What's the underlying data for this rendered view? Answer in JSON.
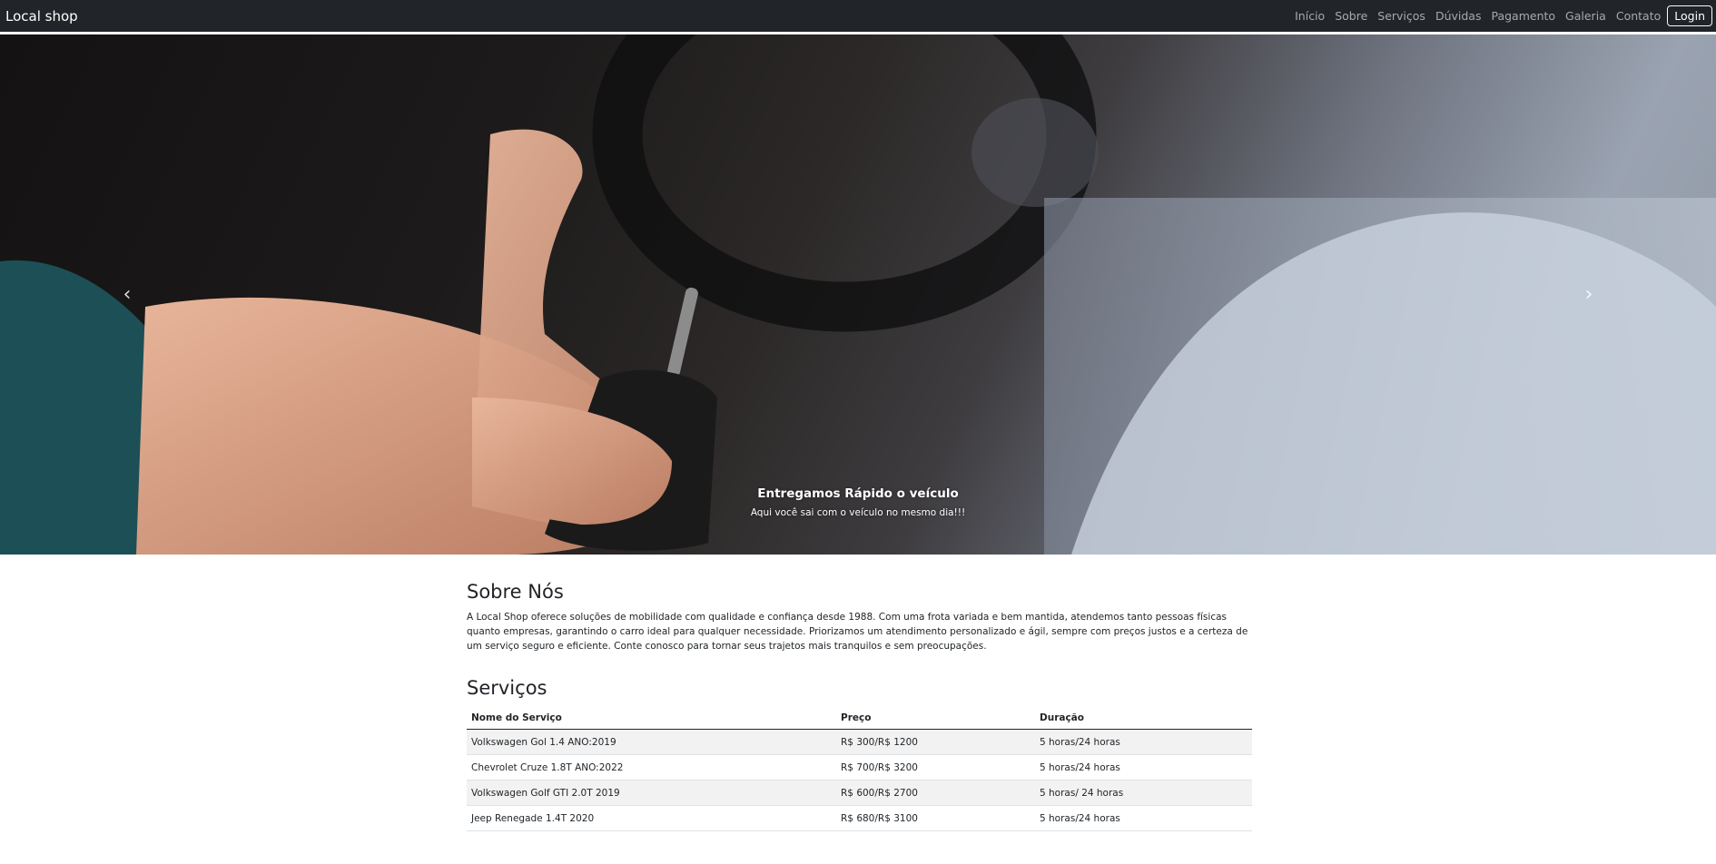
{
  "navbar": {
    "brand": "Local shop",
    "links": [
      "Início",
      "Sobre",
      "Serviços",
      "Dúvidas",
      "Pagamento",
      "Galeria",
      "Contato"
    ],
    "login_label": "Login"
  },
  "carousel": {
    "caption_title": "Entregamos Rápido o veículo",
    "caption_text": "Aqui você sai com o veículo no mesmo dia!!!",
    "prev_icon": "chevron-left-icon",
    "next_icon": "chevron-right-icon"
  },
  "about": {
    "title": "Sobre Nós",
    "text": "A Local Shop oferece soluções de mobilidade com qualidade e confiança desde 1988. Com uma frota variada e bem mantida, atendemos tanto pessoas físicas quanto empresas, garantindo o carro ideal para qualquer necessidade. Priorizamos um atendimento personalizado e ágil, sempre com preços justos e a certeza de um serviço seguro e eficiente. Conte conosco para tornar seus trajetos mais tranquilos e sem preocupações."
  },
  "services": {
    "title": "Serviços",
    "headers": [
      "Nome do Serviço",
      "Preço",
      "Duração"
    ],
    "rows": [
      [
        "Volkswagen Gol 1.4 ANO:2019",
        "R$ 300/R$ 1200",
        "5 horas/24 horas"
      ],
      [
        "Chevrolet Cruze 1.8T ANO:2022",
        "R$ 700/R$ 3200",
        "5 horas/24 horas"
      ],
      [
        "Volkswagen Golf GTI 2.0T 2019",
        "R$ 600/R$ 2700",
        "5 horas/ 24 horas"
      ],
      [
        "Jeep Renegade 1.4T 2020",
        "R$ 680/R$ 3100",
        "5 horas/24 horas"
      ]
    ]
  },
  "colors": {
    "navbar_bg": "#212529",
    "table_stripe": "#f2f2f2"
  }
}
